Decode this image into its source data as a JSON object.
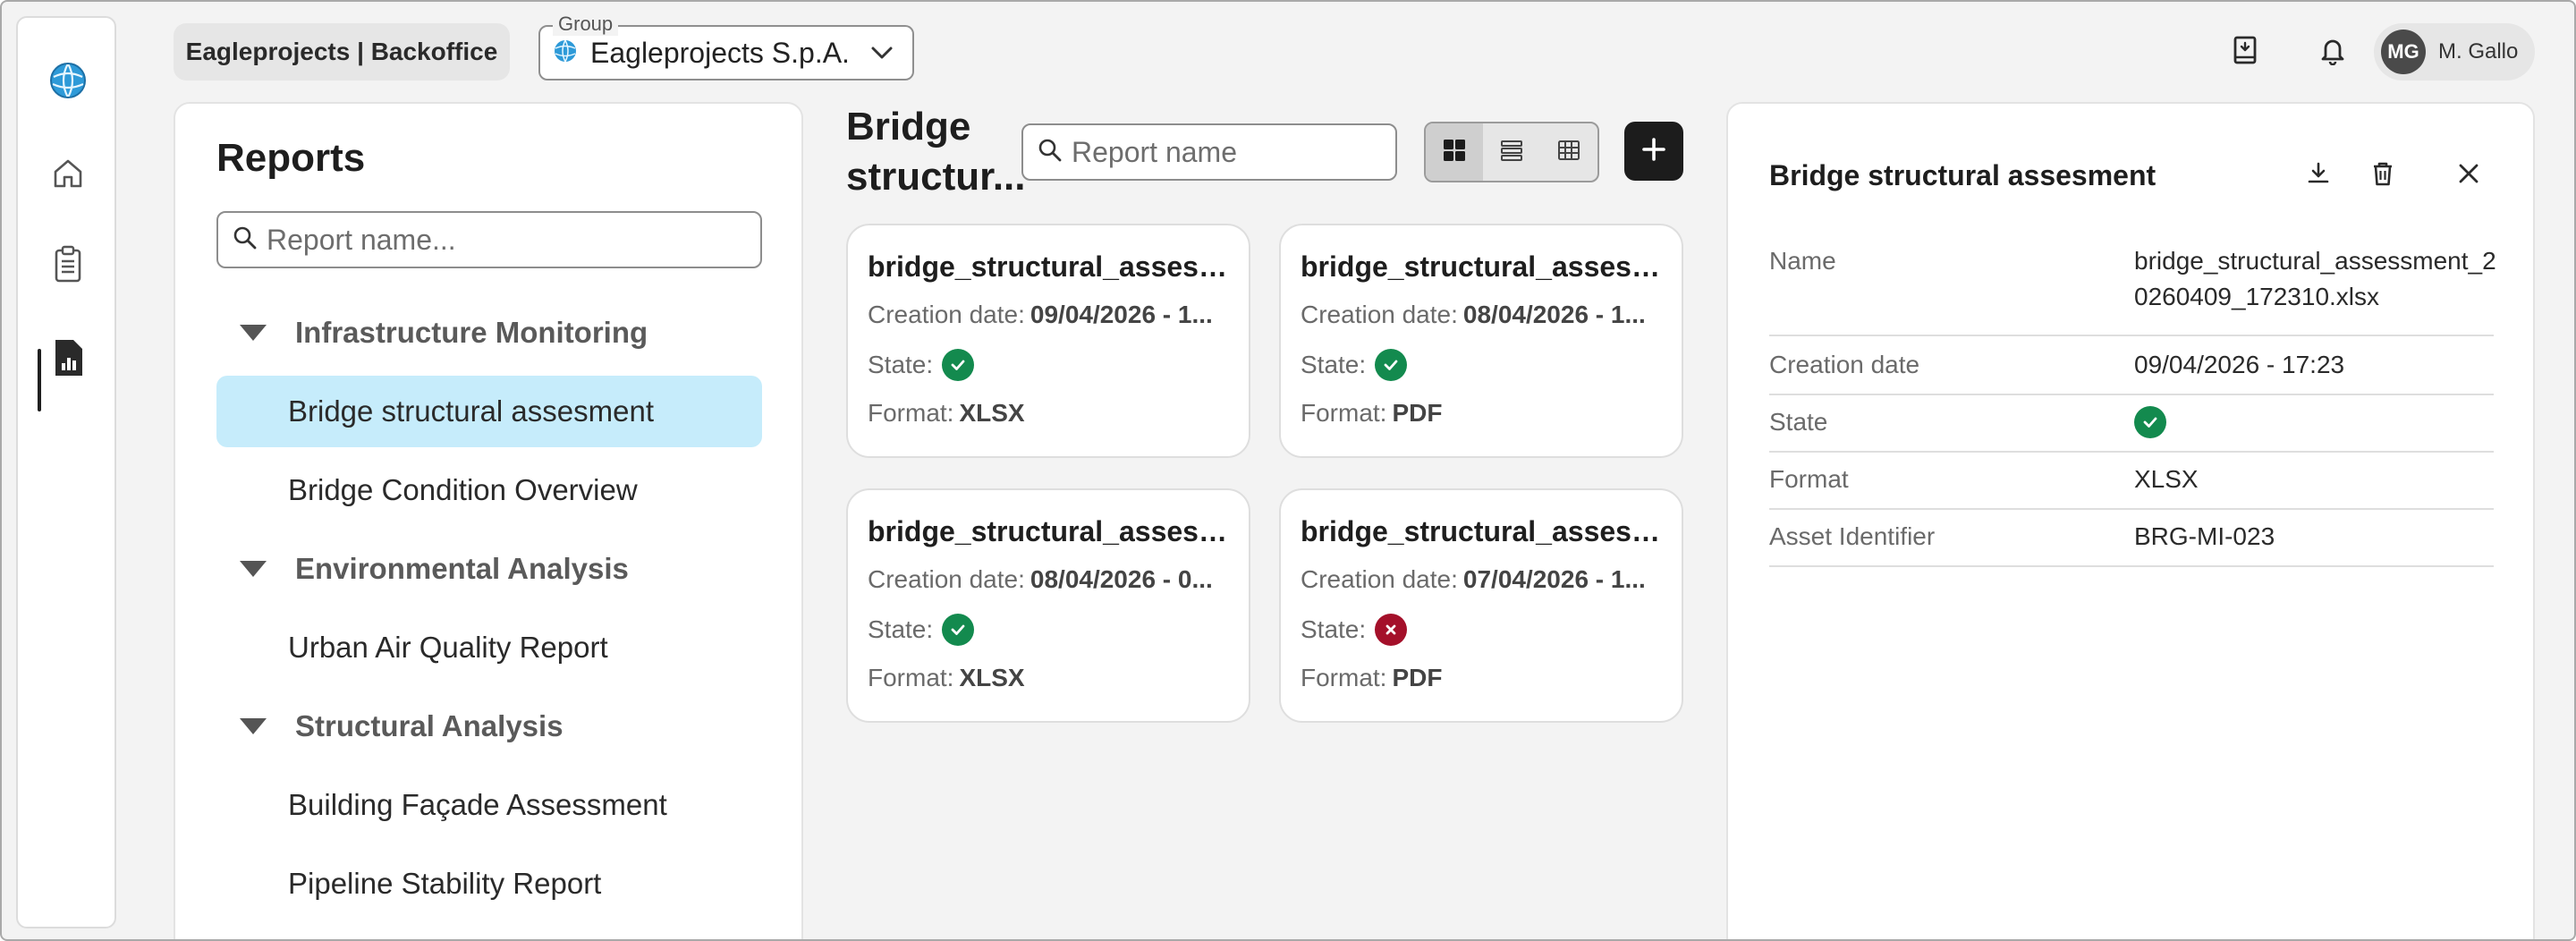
{
  "header": {
    "org_label": "Eagleprojects | Backoffice",
    "group_legend": "Group",
    "group_value": "Eagleprojects S.p.A.",
    "user_initials": "MG",
    "user_name": "M. Gallo"
  },
  "rail": {
    "items": [
      {
        "icon": "home-icon"
      },
      {
        "icon": "clipboard-icon"
      },
      {
        "icon": "report-icon",
        "active": true
      }
    ]
  },
  "reports": {
    "title": "Reports",
    "search_placeholder": "Report name...",
    "groups": [
      {
        "label": "Infrastructure Monitoring",
        "items": [
          "Bridge structural assesment",
          "Bridge Condition Overview"
        ]
      },
      {
        "label": "Environmental Analysis",
        "items": [
          "Urban Air Quality Report"
        ]
      },
      {
        "label": "Structural Analysis",
        "items": [
          "Building Façade Assessment",
          "Pipeline Stability Report"
        ]
      }
    ],
    "selected": "Bridge structural assesment"
  },
  "middle": {
    "title": "Bridge structur...",
    "search_placeholder": "Report name",
    "cards": [
      {
        "title": "bridge_structural_assessm...",
        "creation_label": "Creation date:",
        "creation_value": "09/04/2026  -  1...",
        "state_label": "State:",
        "state": "success",
        "format_label": "Format:",
        "format_value": "XLSX"
      },
      {
        "title": "bridge_structural_assessm...",
        "creation_label": "Creation date:",
        "creation_value": "08/04/2026  -  1...",
        "state_label": "State:",
        "state": "success",
        "format_label": "Format:",
        "format_value": "PDF"
      },
      {
        "title": "bridge_structural_assessm...",
        "creation_label": "Creation date:",
        "creation_value": "08/04/2026  -  0...",
        "state_label": "State:",
        "state": "success",
        "format_label": "Format:",
        "format_value": "XLSX"
      },
      {
        "title": "bridge_structural_assessm...",
        "creation_label": "Creation date:",
        "creation_value": "07/04/2026  -  1...",
        "state_label": "State:",
        "state": "error",
        "format_label": "Format:",
        "format_value": "PDF"
      }
    ]
  },
  "detail": {
    "title": "Bridge structural assesment",
    "rows": [
      {
        "label": "Name",
        "value": "bridge_structural_assessment_20260409_172310.xlsx"
      },
      {
        "label": "Creation date",
        "value": "09/04/2026 - 17:23"
      },
      {
        "label": "State",
        "value": "success"
      },
      {
        "label": "Format",
        "value": "XLSX"
      },
      {
        "label": "Asset Identifier",
        "value": "BRG-MI-023"
      }
    ]
  },
  "colors": {
    "selected_bg": "#c6ecfb",
    "success": "#138a4e",
    "error": "#a4102a",
    "dark": "#1c1c1c"
  }
}
